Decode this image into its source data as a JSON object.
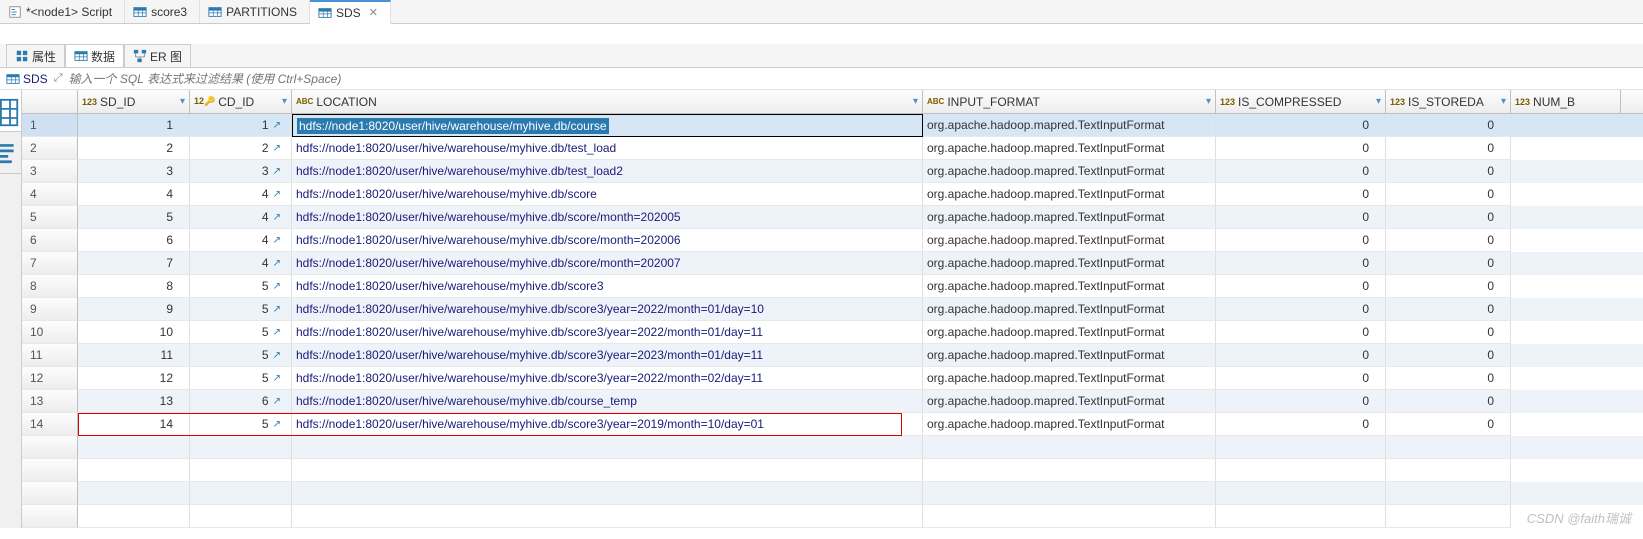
{
  "tabs": [
    {
      "label": "*<node1> Script",
      "icon": "script"
    },
    {
      "label": "score3",
      "icon": "table"
    },
    {
      "label": "PARTITIONS",
      "icon": "table"
    },
    {
      "label": "SDS",
      "icon": "table",
      "active": true
    }
  ],
  "sub_tabs": [
    {
      "label": "属性",
      "icon": "props"
    },
    {
      "label": "数据",
      "icon": "data",
      "active": true
    },
    {
      "label": "ER 图",
      "icon": "er"
    }
  ],
  "filter": {
    "link_label": "SDS",
    "placeholder": "输入一个 SQL 表达式来过滤结果 (使用 Ctrl+Space)",
    "expand_icon": "expand"
  },
  "side_tabs": [
    {
      "label": "网格",
      "icon": "grid",
      "active": true
    },
    {
      "label": "文本",
      "icon": "text"
    }
  ],
  "columns": [
    {
      "name": "SD_ID",
      "type": "num"
    },
    {
      "name": "CD_ID",
      "type": "fk"
    },
    {
      "name": "LOCATION",
      "type": "abc"
    },
    {
      "name": "INPUT_FORMAT",
      "type": "abc"
    },
    {
      "name": "IS_COMPRESSED",
      "type": "num"
    },
    {
      "name": "IS_STOREDA",
      "type": "num"
    },
    {
      "name": "NUM_B",
      "type": "num"
    }
  ],
  "rows": [
    {
      "n": 1,
      "sd": 1,
      "cd": 1,
      "loc": "hdfs://node1:8020/user/hive/warehouse/myhive.db/course",
      "inp": "org.apache.hadoop.mapred.TextInputFormat",
      "comp": 0,
      "stor": 0,
      "sel": true
    },
    {
      "n": 2,
      "sd": 2,
      "cd": 2,
      "loc": "hdfs://node1:8020/user/hive/warehouse/myhive.db/test_load",
      "inp": "org.apache.hadoop.mapred.TextInputFormat",
      "comp": 0,
      "stor": 0
    },
    {
      "n": 3,
      "sd": 3,
      "cd": 3,
      "loc": "hdfs://node1:8020/user/hive/warehouse/myhive.db/test_load2",
      "inp": "org.apache.hadoop.mapred.TextInputFormat",
      "comp": 0,
      "stor": 0
    },
    {
      "n": 4,
      "sd": 4,
      "cd": 4,
      "loc": "hdfs://node1:8020/user/hive/warehouse/myhive.db/score",
      "inp": "org.apache.hadoop.mapred.TextInputFormat",
      "comp": 0,
      "stor": 0
    },
    {
      "n": 5,
      "sd": 5,
      "cd": 4,
      "loc": "hdfs://node1:8020/user/hive/warehouse/myhive.db/score/month=202005",
      "inp": "org.apache.hadoop.mapred.TextInputFormat",
      "comp": 0,
      "stor": 0
    },
    {
      "n": 6,
      "sd": 6,
      "cd": 4,
      "loc": "hdfs://node1:8020/user/hive/warehouse/myhive.db/score/month=202006",
      "inp": "org.apache.hadoop.mapred.TextInputFormat",
      "comp": 0,
      "stor": 0
    },
    {
      "n": 7,
      "sd": 7,
      "cd": 4,
      "loc": "hdfs://node1:8020/user/hive/warehouse/myhive.db/score/month=202007",
      "inp": "org.apache.hadoop.mapred.TextInputFormat",
      "comp": 0,
      "stor": 0
    },
    {
      "n": 8,
      "sd": 8,
      "cd": 5,
      "loc": "hdfs://node1:8020/user/hive/warehouse/myhive.db/score3",
      "inp": "org.apache.hadoop.mapred.TextInputFormat",
      "comp": 0,
      "stor": 0
    },
    {
      "n": 9,
      "sd": 9,
      "cd": 5,
      "loc": "hdfs://node1:8020/user/hive/warehouse/myhive.db/score3/year=2022/month=01/day=10",
      "inp": "org.apache.hadoop.mapred.TextInputFormat",
      "comp": 0,
      "stor": 0
    },
    {
      "n": 10,
      "sd": 10,
      "cd": 5,
      "loc": "hdfs://node1:8020/user/hive/warehouse/myhive.db/score3/year=2022/month=01/day=11",
      "inp": "org.apache.hadoop.mapred.TextInputFormat",
      "comp": 0,
      "stor": 0
    },
    {
      "n": 11,
      "sd": 11,
      "cd": 5,
      "loc": "hdfs://node1:8020/user/hive/warehouse/myhive.db/score3/year=2023/month=01/day=11",
      "inp": "org.apache.hadoop.mapred.TextInputFormat",
      "comp": 0,
      "stor": 0
    },
    {
      "n": 12,
      "sd": 12,
      "cd": 5,
      "loc": "hdfs://node1:8020/user/hive/warehouse/myhive.db/score3/year=2022/month=02/day=11",
      "inp": "org.apache.hadoop.mapred.TextInputFormat",
      "comp": 0,
      "stor": 0
    },
    {
      "n": 13,
      "sd": 13,
      "cd": 6,
      "loc": "hdfs://node1:8020/user/hive/warehouse/myhive.db/course_temp",
      "inp": "org.apache.hadoop.mapred.TextInputFormat",
      "comp": 0,
      "stor": 0
    },
    {
      "n": 14,
      "sd": 14,
      "cd": 5,
      "loc": "hdfs://node1:8020/user/hive/warehouse/myhive.db/score3/year=2019/month=10/day=01",
      "inp": "org.apache.hadoop.mapred.TextInputFormat",
      "comp": 0,
      "stor": 0,
      "hl": true
    }
  ],
  "watermark": "CSDN @faith瑞诚"
}
